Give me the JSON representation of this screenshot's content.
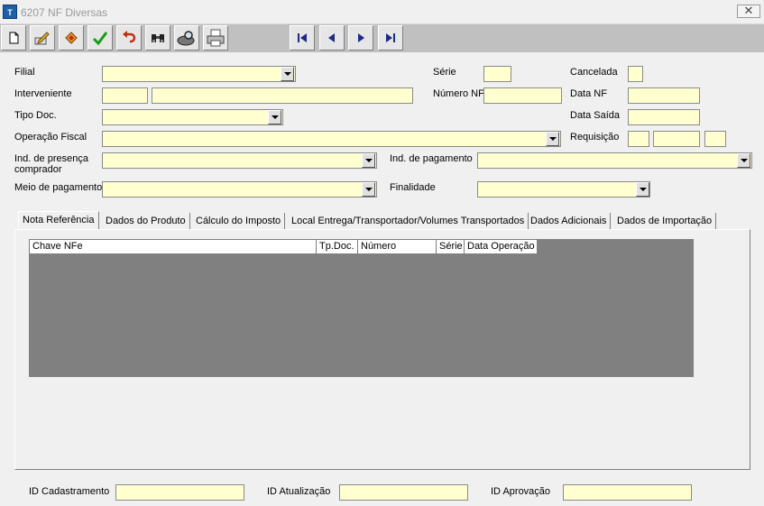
{
  "window": {
    "title": "6207 NF Diversas",
    "app_icon_text": "T",
    "close_glyph": "✕"
  },
  "toolbar": {
    "buttons": [
      {
        "name": "new-document-button",
        "icon": "new-document-icon"
      },
      {
        "name": "edit-button",
        "icon": "edit-pencil-icon"
      },
      {
        "name": "delete-button",
        "icon": "eraser-icon"
      },
      {
        "name": "confirm-button",
        "icon": "checkmark-icon"
      },
      {
        "name": "undo-button",
        "icon": "undo-arrow-icon"
      },
      {
        "name": "search-button",
        "icon": "binoculars-icon"
      },
      {
        "name": "filter-button",
        "icon": "magnifier-icon"
      },
      {
        "name": "print-button",
        "icon": "printer-icon"
      }
    ],
    "nav": [
      "first-record-icon",
      "previous-record-icon",
      "next-record-icon",
      "last-record-icon"
    ]
  },
  "form": {
    "filial": {
      "label": "Filial",
      "value": ""
    },
    "serie": {
      "label": "Série",
      "value": ""
    },
    "cancelada": {
      "label": "Cancelada",
      "value": ""
    },
    "interveniente": {
      "label": "Interveniente",
      "code": "",
      "name": ""
    },
    "numero_nf": {
      "label": "Número NF",
      "value": ""
    },
    "data_nf": {
      "label": "Data NF",
      "value": ""
    },
    "tipo_doc": {
      "label": "Tipo Doc.",
      "value": ""
    },
    "data_saida": {
      "label": "Data Saída",
      "value": ""
    },
    "operacao_fiscal": {
      "label": "Operação Fiscal",
      "value": ""
    },
    "requisicao": {
      "label": "Requisição",
      "values": [
        "",
        "",
        ""
      ]
    },
    "ind_presenca": {
      "label_line1": "Ind. de presença",
      "label_line2": "comprador",
      "value": ""
    },
    "ind_pagamento": {
      "label": "Ind. de pagamento",
      "value": ""
    },
    "meio_pagamento": {
      "label": "Meio de pagamento",
      "value": ""
    },
    "finalidade": {
      "label": "Finalidade",
      "value": ""
    }
  },
  "tabs": [
    {
      "label": "Nota Referência",
      "active": true
    },
    {
      "label": "Dados do Produto",
      "active": false
    },
    {
      "label": "Cálculo do Imposto",
      "active": false
    },
    {
      "label": "Local Entrega/Transportador/Volumes Transportados",
      "active": false
    },
    {
      "label": "Dados Adicionais",
      "active": false
    },
    {
      "label": "Dados de Importação",
      "active": false
    }
  ],
  "grid": {
    "columns": [
      "Chave NFe",
      "Tp.Doc.",
      "Número",
      "Série",
      "Data Operação"
    ],
    "rows": []
  },
  "footer": {
    "id_cadastramento": {
      "label": "ID Cadastramento",
      "value": ""
    },
    "id_atualizacao": {
      "label": "ID Atualização",
      "value": ""
    },
    "id_aprovacao": {
      "label": "ID Aprovação",
      "value": ""
    }
  }
}
